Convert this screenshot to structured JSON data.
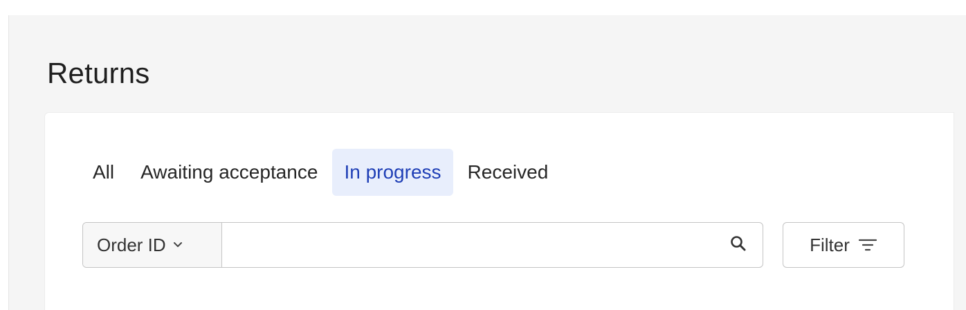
{
  "page": {
    "title": "Returns"
  },
  "tabs": [
    {
      "label": "All",
      "active": false
    },
    {
      "label": "Awaiting acceptance",
      "active": false
    },
    {
      "label": "In progress",
      "active": true
    },
    {
      "label": "Received",
      "active": false
    }
  ],
  "search": {
    "field_label": "Order ID",
    "value": "",
    "placeholder": ""
  },
  "filter": {
    "label": "Filter"
  },
  "colors": {
    "active_tab_bg": "#e8eefc",
    "active_tab_text": "#1f3fb6",
    "page_bg": "#f5f5f5"
  },
  "icons": {
    "field_chevron": "chevron-down-icon",
    "search": "search-icon",
    "filter": "filter-icon"
  }
}
